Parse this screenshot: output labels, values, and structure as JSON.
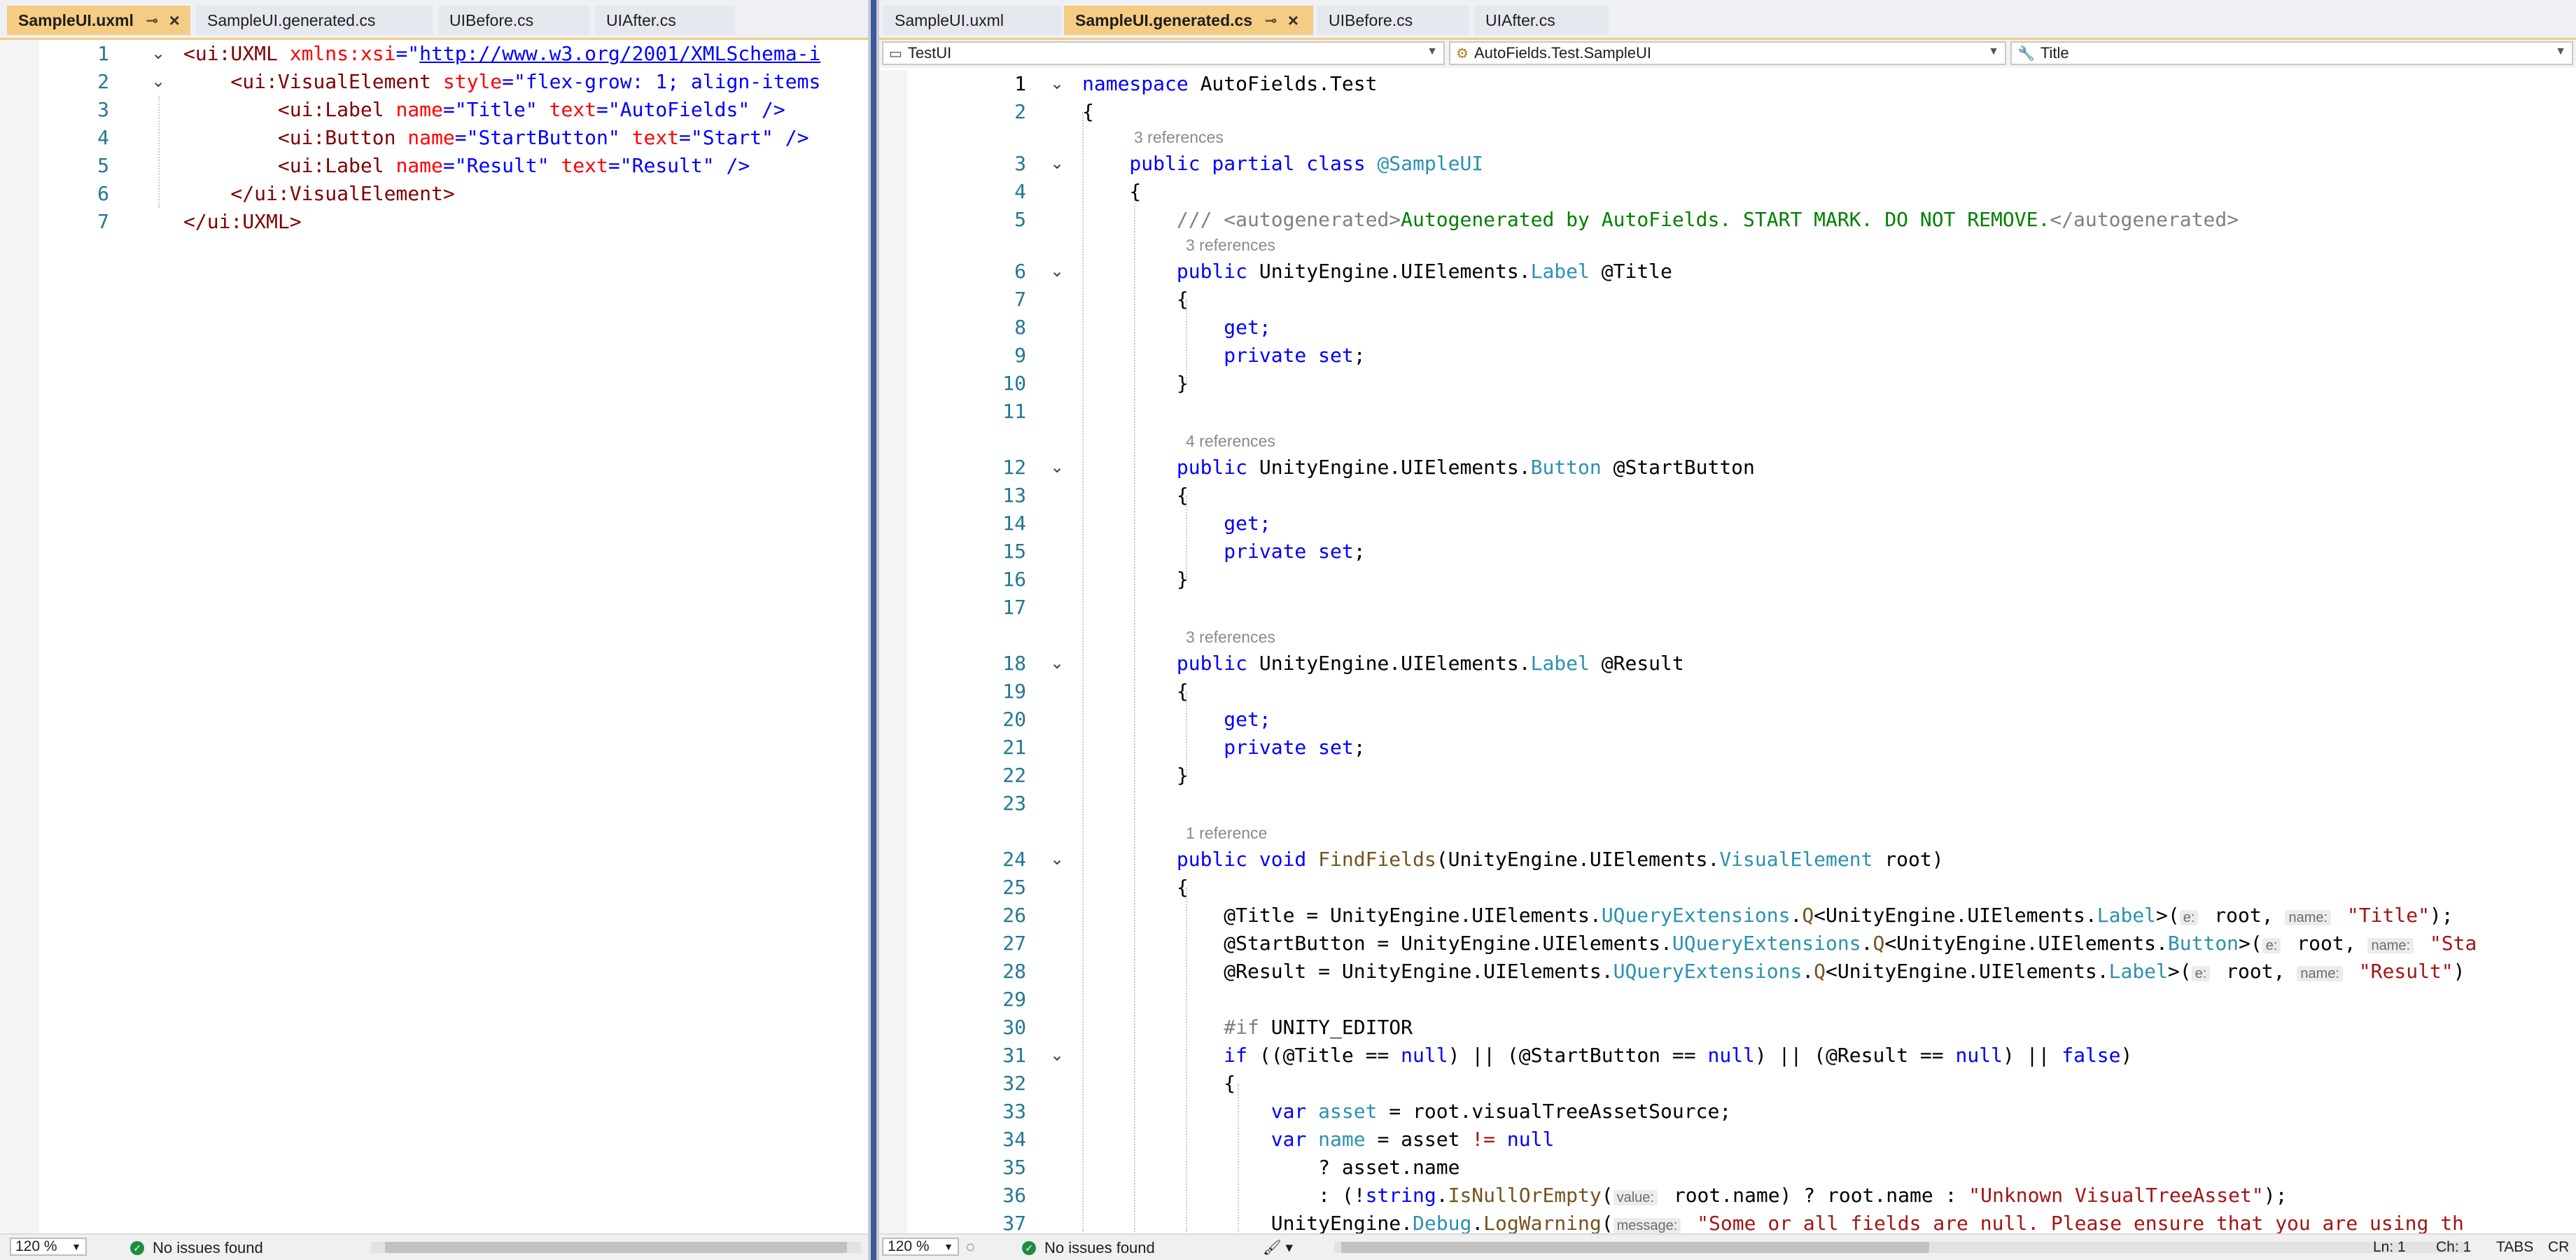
{
  "left": {
    "tabs": [
      {
        "label": "SampleUI.uxml",
        "active": true
      },
      {
        "label": "SampleUI.generated.cs",
        "active": false
      },
      {
        "label": "UIBefore.cs",
        "active": false
      },
      {
        "label": "UIAfter.cs",
        "active": false
      }
    ],
    "line_numbers": [
      "1",
      "2",
      "3",
      "4",
      "5",
      "6",
      "7"
    ],
    "lines": {
      "l1a": "<ui:UXML ",
      "l1b": "xmlns:xsi",
      "l1c": "=\"",
      "l1d": "http://www.w3.org/2001/XMLSchema-i",
      "l2a": "    <ui:VisualElement ",
      "l2b": "style",
      "l2c": "=\"flex-grow: 1; align-items",
      "l3a": "        <ui:Label ",
      "l3b": "name",
      "l3c": "=\"Title\" ",
      "l3d": "text",
      "l3e": "=\"AutoFields\" />",
      "l4a": "        <ui:Button ",
      "l4b": "name",
      "l4c": "=\"StartButton\" ",
      "l4d": "text",
      "l4e": "=\"Start\" />",
      "l5a": "        <ui:Label ",
      "l5b": "name",
      "l5c": "=\"Result\" ",
      "l5d": "text",
      "l5e": "=\"Result\" />",
      "l6": "    </ui:VisualElement>",
      "l7": "</ui:UXML>"
    },
    "status": {
      "zoom": "120 %",
      "issues": "No issues found"
    }
  },
  "right": {
    "tabs": [
      {
        "label": "SampleUI.uxml",
        "active": false
      },
      {
        "label": "SampleUI.generated.cs",
        "active": true
      },
      {
        "label": "UIBefore.cs",
        "active": false
      },
      {
        "label": "UIAfter.cs",
        "active": false
      }
    ],
    "nav": {
      "project": "TestUI",
      "type": "AutoFields.Test.SampleUI",
      "member": "Title"
    },
    "line_numbers": [
      "1",
      "2",
      "3",
      "4",
      "5",
      "6",
      "7",
      "8",
      "9",
      "10",
      "11",
      "12",
      "13",
      "14",
      "15",
      "16",
      "17",
      "18",
      "19",
      "20",
      "21",
      "22",
      "23",
      "24",
      "25",
      "26",
      "27",
      "28",
      "29",
      "30",
      "31",
      "32",
      "33",
      "34",
      "35",
      "36",
      "37"
    ],
    "refs": {
      "r3": "3 references",
      "r6": "3 references",
      "r12": "4 references",
      "r18": "3 references",
      "r24": "1 reference"
    },
    "code": {
      "c1a": "namespace",
      "c1b": " AutoFields.Test",
      "c2": "{",
      "c3a": "    public partial class ",
      "c3b": "@SampleUI",
      "c4": "    {",
      "c5a": "        /// ",
      "c5b": "<autogenerated>",
      "c5c": "Autogenerated by AutoFields. START MARK. DO NOT REMOVE.",
      "c5d": "</autogenerated>",
      "c6a": "        public",
      "c6b": " UnityEngine.UIElements.",
      "c6c": "Label",
      "c6d": " @Title",
      "c7": "        {",
      "c8": "            get;",
      "c9a": "            private set",
      "c9b": ";",
      "c10": "        }",
      "c12a": "        public",
      "c12b": " UnityEngine.UIElements.",
      "c12c": "Button",
      "c12d": " @StartButton",
      "c13": "        {",
      "c14": "            get;",
      "c15a": "            private set",
      "c15b": ";",
      "c16": "        }",
      "c18a": "        public",
      "c18b": " UnityEngine.UIElements.",
      "c18c": "Label",
      "c18d": " @Result",
      "c19": "        {",
      "c20": "            get;",
      "c21a": "            private set",
      "c21b": ";",
      "c22": "        }",
      "c24a": "        public void ",
      "c24b": "FindFields",
      "c24c": "(UnityEngine.UIElements.",
      "c24d": "VisualElement",
      "c24e": " root)",
      "c25": "        {",
      "c26a": "            @Title = UnityEngine.UIElements.",
      "c26b": "UQueryExtensions",
      "c26c": ".",
      "c26d": "Q",
      "c26e": "<UnityEngine.UIElements.",
      "c26f": "Label",
      "c26g": ">(",
      "c26h": "e:",
      "c26i": " root, ",
      "c26j": "name:",
      "c26k": " \"Title\"",
      "c26l": ");",
      "c27a": "            @StartButton = UnityEngine.UIElements.",
      "c27b": "UQueryExtensions",
      "c27c": ".",
      "c27d": "Q",
      "c27e": "<UnityEngine.UIElements.",
      "c27f": "Button",
      "c27g": ">(",
      "c27h": "e:",
      "c27i": " root, ",
      "c27j": "name:",
      "c27k": " \"Sta",
      "c28a": "            @Result = UnityEngine.UIElements.",
      "c28b": "UQueryExtensions",
      "c28c": ".",
      "c28d": "Q",
      "c28e": "<UnityEngine.UIElements.",
      "c28f": "Label",
      "c28g": ">(",
      "c28h": "e:",
      "c28i": " root, ",
      "c28j": "name:",
      "c28k": " \"Result\"",
      "c28l": ")",
      "c30a": "            #if",
      "c30b": " UNITY_EDITOR",
      "c31a": "            if",
      "c31b": " ((@Title == ",
      "c31c": "null",
      "c31d": ") || (@StartButton == ",
      "c31e": "null",
      "c31f": ") || (@Result == ",
      "c31g": "null",
      "c31h": ") || ",
      "c31i": "false",
      "c31j": ")",
      "c32": "            {",
      "c33a": "                var",
      "c33b": " asset",
      "c33c": " = root.visualTreeAssetSource;",
      "c34a": "                var",
      "c34b": " name",
      "c34c": " = asset ",
      "c34d": "!=",
      "c34e": " null",
      "c35a": "                    ? asset.name",
      "c36a": "                    : (!",
      "c36b": "string",
      "c36c": ".",
      "c36d": "IsNullOrEmpty",
      "c36e": "(",
      "c36f": "value:",
      "c36g": " root.name) ? root.name : ",
      "c36h": "\"Unknown VisualTreeAsset\"",
      "c36i": ");",
      "c37a": "                UnityEngine.",
      "c37b": "Debug",
      "c37c": ".",
      "c37d": "LogWarning",
      "c37e": "(",
      "c37f": "message:",
      "c37g": " \"Some or all fields are null. Please ensure that you are using th"
    },
    "status": {
      "zoom": "120 %",
      "issues": "No issues found",
      "ln": "Ln: 1",
      "ch": "Ch: 1",
      "tabs": "TABS",
      "eol": "CR"
    }
  },
  "colors": {
    "active_tab": "#f5cc84",
    "keyword": "#0000ff",
    "type": "#2b91af",
    "string": "#a31515",
    "comment": "#008000",
    "line_number": "#237893"
  }
}
